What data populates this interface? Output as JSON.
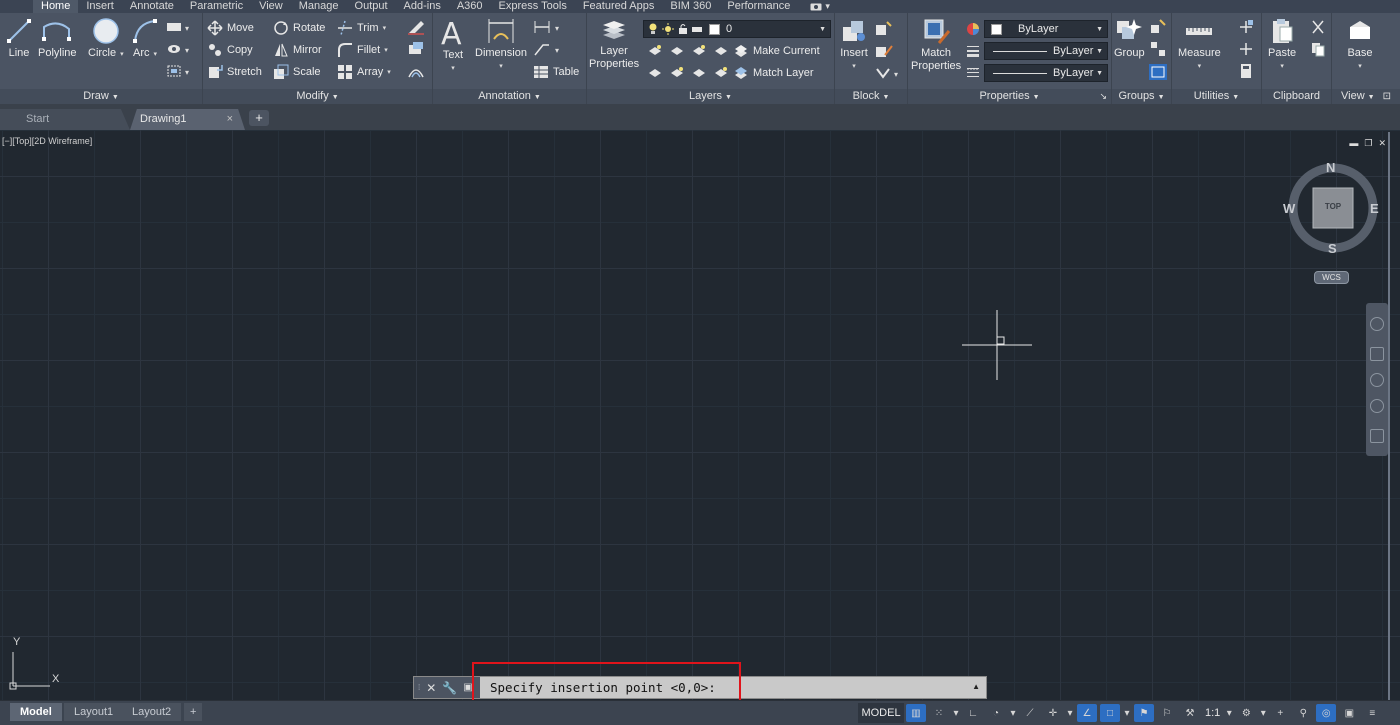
{
  "ribbon_tabs": [
    "Home",
    "Insert",
    "Annotate",
    "Parametric",
    "View",
    "Manage",
    "Output",
    "Add-ins",
    "A360",
    "Express Tools",
    "Featured Apps",
    "BIM 360",
    "Performance"
  ],
  "panels": {
    "draw": {
      "title": "Draw",
      "line": "Line",
      "polyline": "Polyline",
      "circle": "Circle",
      "arc": "Arc"
    },
    "modify": {
      "title": "Modify",
      "move": "Move",
      "rotate": "Rotate",
      "trim": "Trim",
      "copy": "Copy",
      "mirror": "Mirror",
      "fillet": "Fillet",
      "stretch": "Stretch",
      "scale": "Scale",
      "array": "Array"
    },
    "annotation": {
      "title": "Annotation",
      "text": "Text",
      "dimension": "Dimension",
      "table": "Table"
    },
    "layers": {
      "title": "Layers",
      "layer_properties_1": "Layer",
      "layer_properties_2": "Properties",
      "current_layer": "0",
      "make_current": "Make Current",
      "match_layer": "Match Layer"
    },
    "block": {
      "title": "Block",
      "insert": "Insert"
    },
    "properties": {
      "title": "Properties",
      "match_properties_1": "Match",
      "match_properties_2": "Properties",
      "color": "ByLayer",
      "linetype": "ByLayer",
      "lineweight": "ByLayer"
    },
    "groups": {
      "title": "Groups",
      "group": "Group"
    },
    "utilities": {
      "title": "Utilities",
      "measure": "Measure"
    },
    "clipboard": {
      "title": "Clipboard",
      "paste": "Paste"
    },
    "view": {
      "title": "View",
      "base": "Base"
    }
  },
  "file_tabs": {
    "start": "Start",
    "drawing": "Drawing1",
    "close": "×",
    "add": "+"
  },
  "viewport": {
    "label": "[−][Top][2D Wireframe]"
  },
  "viewcube": {
    "north": "N",
    "south": "S",
    "east": "E",
    "west": "W",
    "face": "TOP",
    "wcs": "WCS"
  },
  "ucs": {
    "x": "X",
    "y": "Y"
  },
  "command_line": {
    "prompt": "Specify insertion point <0,0>:"
  },
  "status_bar": {
    "layout_tabs": [
      "Model",
      "Layout1",
      "Layout2"
    ],
    "add": "+",
    "model": "MODEL",
    "scale": "1:1"
  },
  "colors": {
    "accent_blue": "#2d6ec2",
    "highlight_red": "#e0141b",
    "canvas": "#212830"
  }
}
